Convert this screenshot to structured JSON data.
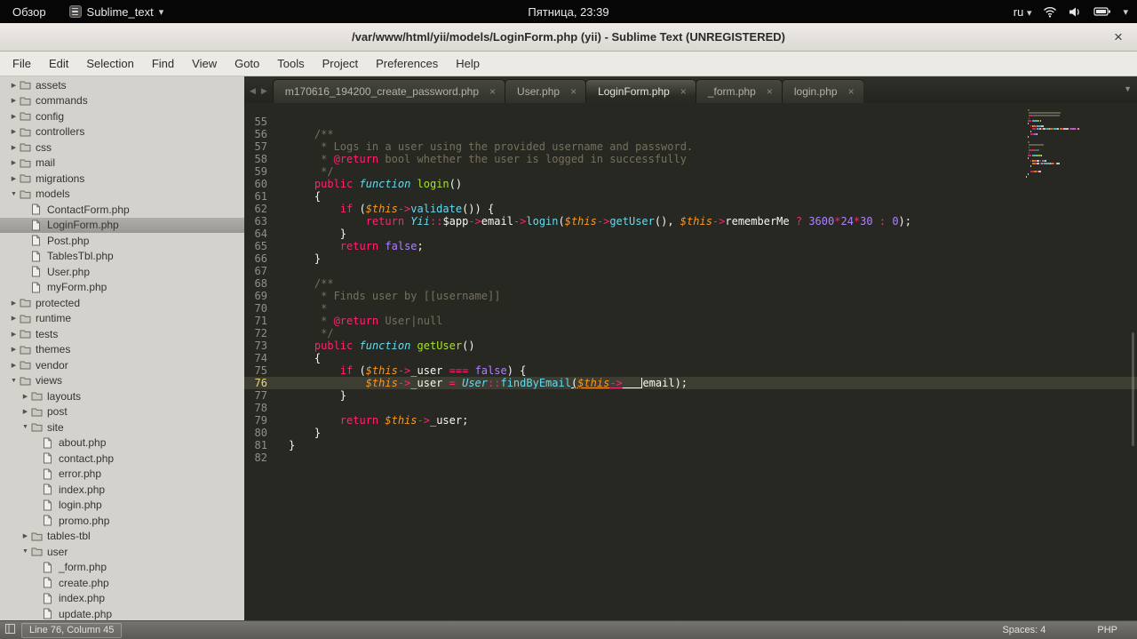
{
  "system_bar": {
    "activities_label": "Обзор",
    "app_name": "Sublime_text",
    "clock": "Пятница, 23:39",
    "keyboard_layout": "ru"
  },
  "glyphs": {
    "menu_caret": "▾",
    "expanded": "▼",
    "collapsed": "▶",
    "tab_prev": "◀",
    "tab_next": "▶",
    "tab_overflow": "▼",
    "close": "×"
  },
  "window": {
    "title": "/var/www/html/yii/models/LoginForm.php (yii) - Sublime Text (UNREGISTERED)",
    "close_glyph": "×"
  },
  "menu_bar": {
    "items": [
      "File",
      "Edit",
      "Selection",
      "Find",
      "View",
      "Goto",
      "Tools",
      "Project",
      "Preferences",
      "Help"
    ]
  },
  "sidebar": {
    "items": [
      {
        "label": "assets",
        "level": 0,
        "type": "folder",
        "state": "collapsed"
      },
      {
        "label": "commands",
        "level": 0,
        "type": "folder",
        "state": "collapsed"
      },
      {
        "label": "config",
        "level": 0,
        "type": "folder",
        "state": "collapsed"
      },
      {
        "label": "controllers",
        "level": 0,
        "type": "folder",
        "state": "collapsed"
      },
      {
        "label": "css",
        "level": 0,
        "type": "folder",
        "state": "collapsed"
      },
      {
        "label": "mail",
        "level": 0,
        "type": "folder",
        "state": "collapsed"
      },
      {
        "label": "migrations",
        "level": 0,
        "type": "folder",
        "state": "collapsed"
      },
      {
        "label": "models",
        "level": 0,
        "type": "folder",
        "state": "expanded"
      },
      {
        "label": "ContactForm.php",
        "level": 1,
        "type": "file",
        "state": "none"
      },
      {
        "label": "LoginForm.php",
        "level": 1,
        "type": "file",
        "state": "none",
        "selected": true
      },
      {
        "label": "Post.php",
        "level": 1,
        "type": "file",
        "state": "none"
      },
      {
        "label": "TablesTbl.php",
        "level": 1,
        "type": "file",
        "state": "none"
      },
      {
        "label": "User.php",
        "level": 1,
        "type": "file",
        "state": "none"
      },
      {
        "label": "myForm.php",
        "level": 1,
        "type": "file",
        "state": "none"
      },
      {
        "label": "protected",
        "level": 0,
        "type": "folder",
        "state": "collapsed"
      },
      {
        "label": "runtime",
        "level": 0,
        "type": "folder",
        "state": "collapsed"
      },
      {
        "label": "tests",
        "level": 0,
        "type": "folder",
        "state": "collapsed"
      },
      {
        "label": "themes",
        "level": 0,
        "type": "folder",
        "state": "collapsed"
      },
      {
        "label": "vendor",
        "level": 0,
        "type": "folder",
        "state": "collapsed"
      },
      {
        "label": "views",
        "level": 0,
        "type": "folder",
        "state": "expanded"
      },
      {
        "label": "layouts",
        "level": 1,
        "type": "folder",
        "state": "collapsed"
      },
      {
        "label": "post",
        "level": 1,
        "type": "folder",
        "state": "collapsed"
      },
      {
        "label": "site",
        "level": 1,
        "type": "folder",
        "state": "expanded"
      },
      {
        "label": "about.php",
        "level": 2,
        "type": "file",
        "state": "none"
      },
      {
        "label": "contact.php",
        "level": 2,
        "type": "file",
        "state": "none"
      },
      {
        "label": "error.php",
        "level": 2,
        "type": "file",
        "state": "none"
      },
      {
        "label": "index.php",
        "level": 2,
        "type": "file",
        "state": "none"
      },
      {
        "label": "login.php",
        "level": 2,
        "type": "file",
        "state": "none"
      },
      {
        "label": "promo.php",
        "level": 2,
        "type": "file",
        "state": "none"
      },
      {
        "label": "tables-tbl",
        "level": 1,
        "type": "folder",
        "state": "collapsed"
      },
      {
        "label": "user",
        "level": 1,
        "type": "folder",
        "state": "expanded"
      },
      {
        "label": "_form.php",
        "level": 2,
        "type": "file",
        "state": "none"
      },
      {
        "label": "create.php",
        "level": 2,
        "type": "file",
        "state": "none"
      },
      {
        "label": "index.php",
        "level": 2,
        "type": "file",
        "state": "none"
      },
      {
        "label": "update.php",
        "level": 2,
        "type": "file",
        "state": "none"
      }
    ]
  },
  "tab_bar": {
    "tabs": [
      {
        "label": "m170616_194200_create_password.php",
        "active": false
      },
      {
        "label": "User.php",
        "active": false
      },
      {
        "label": "LoginForm.php",
        "active": true
      },
      {
        "label": "_form.php",
        "active": false
      },
      {
        "label": "login.php",
        "active": false
      }
    ],
    "close_glyph": "×"
  },
  "editor": {
    "active_line": 76,
    "cursor": {
      "line": 76,
      "column": 45
    },
    "lines": [
      {
        "n": 55,
        "tokens": []
      },
      {
        "n": 56,
        "tokens": [
          [
            "cm",
            "    /**"
          ]
        ]
      },
      {
        "n": 57,
        "tokens": [
          [
            "cm",
            "     * Logs in a user using the provided username and password."
          ]
        ]
      },
      {
        "n": 58,
        "tokens": [
          [
            "cm",
            "     * "
          ],
          [
            "k",
            "@return"
          ],
          [
            "cm",
            " bool whether the user is logged in successfully"
          ]
        ]
      },
      {
        "n": 59,
        "tokens": [
          [
            "cm",
            "     */"
          ]
        ]
      },
      {
        "n": 60,
        "tokens": [
          [
            "t",
            "    "
          ],
          [
            "k",
            "public"
          ],
          [
            "t",
            " "
          ],
          [
            "kd",
            "function"
          ],
          [
            "t",
            " "
          ],
          [
            "f",
            "login"
          ],
          [
            "t",
            "()"
          ]
        ]
      },
      {
        "n": 61,
        "tokens": [
          [
            "t",
            "    {"
          ]
        ]
      },
      {
        "n": 62,
        "tokens": [
          [
            "t",
            "        "
          ],
          [
            "k",
            "if"
          ],
          [
            "t",
            " ("
          ],
          [
            "v",
            "$this"
          ],
          [
            "k",
            "->"
          ],
          [
            "c",
            "validate"
          ],
          [
            "t",
            "()) {"
          ]
        ]
      },
      {
        "n": 63,
        "tokens": [
          [
            "t",
            "            "
          ],
          [
            "k",
            "return"
          ],
          [
            "t",
            " "
          ],
          [
            "ci",
            "Yii"
          ],
          [
            "k",
            "::"
          ],
          [
            "t",
            "$app"
          ],
          [
            "k",
            "->"
          ],
          [
            "t",
            "email"
          ],
          [
            "k",
            "->"
          ],
          [
            "c",
            "login"
          ],
          [
            "t",
            "("
          ],
          [
            "v",
            "$this"
          ],
          [
            "k",
            "->"
          ],
          [
            "c",
            "getUser"
          ],
          [
            "t",
            "(), "
          ],
          [
            "v",
            "$this"
          ],
          [
            "k",
            "->"
          ],
          [
            "t",
            "rememberMe "
          ],
          [
            "k",
            "?"
          ],
          [
            "t",
            " "
          ],
          [
            "n",
            "3600"
          ],
          [
            "k",
            "*"
          ],
          [
            "n",
            "24"
          ],
          [
            "k",
            "*"
          ],
          [
            "n",
            "30"
          ],
          [
            "t",
            " "
          ],
          [
            "k",
            ":"
          ],
          [
            "t",
            " "
          ],
          [
            "n",
            "0"
          ],
          [
            "t",
            ");"
          ]
        ]
      },
      {
        "n": 64,
        "tokens": [
          [
            "t",
            "        }"
          ]
        ]
      },
      {
        "n": 65,
        "tokens": [
          [
            "t",
            "        "
          ],
          [
            "k",
            "return"
          ],
          [
            "t",
            " "
          ],
          [
            "n",
            "false"
          ],
          [
            "t",
            ";"
          ]
        ]
      },
      {
        "n": 66,
        "tokens": [
          [
            "t",
            "    }"
          ]
        ]
      },
      {
        "n": 67,
        "tokens": []
      },
      {
        "n": 68,
        "tokens": [
          [
            "cm",
            "    /**"
          ]
        ]
      },
      {
        "n": 69,
        "tokens": [
          [
            "cm",
            "     * Finds user by [[username]]"
          ]
        ]
      },
      {
        "n": 70,
        "tokens": [
          [
            "cm",
            "     *"
          ]
        ]
      },
      {
        "n": 71,
        "tokens": [
          [
            "cm",
            "     * "
          ],
          [
            "k",
            "@return"
          ],
          [
            "cm",
            " User|null"
          ]
        ]
      },
      {
        "n": 72,
        "tokens": [
          [
            "cm",
            "     */"
          ]
        ]
      },
      {
        "n": 73,
        "tokens": [
          [
            "t",
            "    "
          ],
          [
            "k",
            "public"
          ],
          [
            "t",
            " "
          ],
          [
            "kd",
            "function"
          ],
          [
            "t",
            " "
          ],
          [
            "f",
            "getUser"
          ],
          [
            "t",
            "()"
          ]
        ]
      },
      {
        "n": 74,
        "tokens": [
          [
            "t",
            "    {"
          ]
        ]
      },
      {
        "n": 75,
        "tokens": [
          [
            "t",
            "        "
          ],
          [
            "k",
            "if"
          ],
          [
            "t",
            " ("
          ],
          [
            "v",
            "$this"
          ],
          [
            "k",
            "->"
          ],
          [
            "t",
            "_user "
          ],
          [
            "k",
            "==="
          ],
          [
            "t",
            " "
          ],
          [
            "n",
            "false"
          ],
          [
            "t",
            ") {"
          ]
        ]
      },
      {
        "n": 76,
        "tokens": [
          [
            "t",
            "            "
          ],
          [
            "v",
            "$this"
          ],
          [
            "k",
            "->"
          ],
          [
            "t",
            "_user "
          ],
          [
            "k",
            "="
          ],
          [
            "t",
            " "
          ],
          [
            "ci",
            "User"
          ],
          [
            "k",
            "::"
          ],
          [
            "c",
            "findByEmail"
          ],
          [
            "tu",
            "("
          ],
          [
            "vu",
            "$this"
          ],
          [
            "ku",
            "->"
          ],
          [
            "tu",
            "   "
          ],
          [
            "caret",
            ""
          ],
          [
            "t",
            "email"
          ],
          [
            "t",
            ");"
          ]
        ]
      },
      {
        "n": 77,
        "tokens": [
          [
            "t",
            "        }"
          ]
        ]
      },
      {
        "n": 78,
        "tokens": []
      },
      {
        "n": 79,
        "tokens": [
          [
            "t",
            "        "
          ],
          [
            "k",
            "return"
          ],
          [
            "t",
            " "
          ],
          [
            "v",
            "$this"
          ],
          [
            "k",
            "->"
          ],
          [
            "t",
            "_user;"
          ]
        ]
      },
      {
        "n": 80,
        "tokens": [
          [
            "t",
            "    }"
          ]
        ]
      },
      {
        "n": 81,
        "tokens": [
          [
            "t",
            "}"
          ]
        ]
      },
      {
        "n": 82,
        "tokens": []
      }
    ]
  },
  "status_bar": {
    "position": "Line 76, Column 45",
    "indentation": "Spaces: 4",
    "syntax": "PHP"
  },
  "colors": {
    "editor_bg": "#272822",
    "active_line_bg": "#3e3d32",
    "gutter_fg": "#8f908a",
    "plain": "#f8f8f2",
    "keyword": "#f92672",
    "function_def": "#a6e22e",
    "function_call": "#66d9ef",
    "class_name": "#66d9ef",
    "variable": "#fd971f",
    "number": "#ae81ff",
    "comment": "#75715e",
    "sidebar_bg": "#d4d2cd"
  }
}
